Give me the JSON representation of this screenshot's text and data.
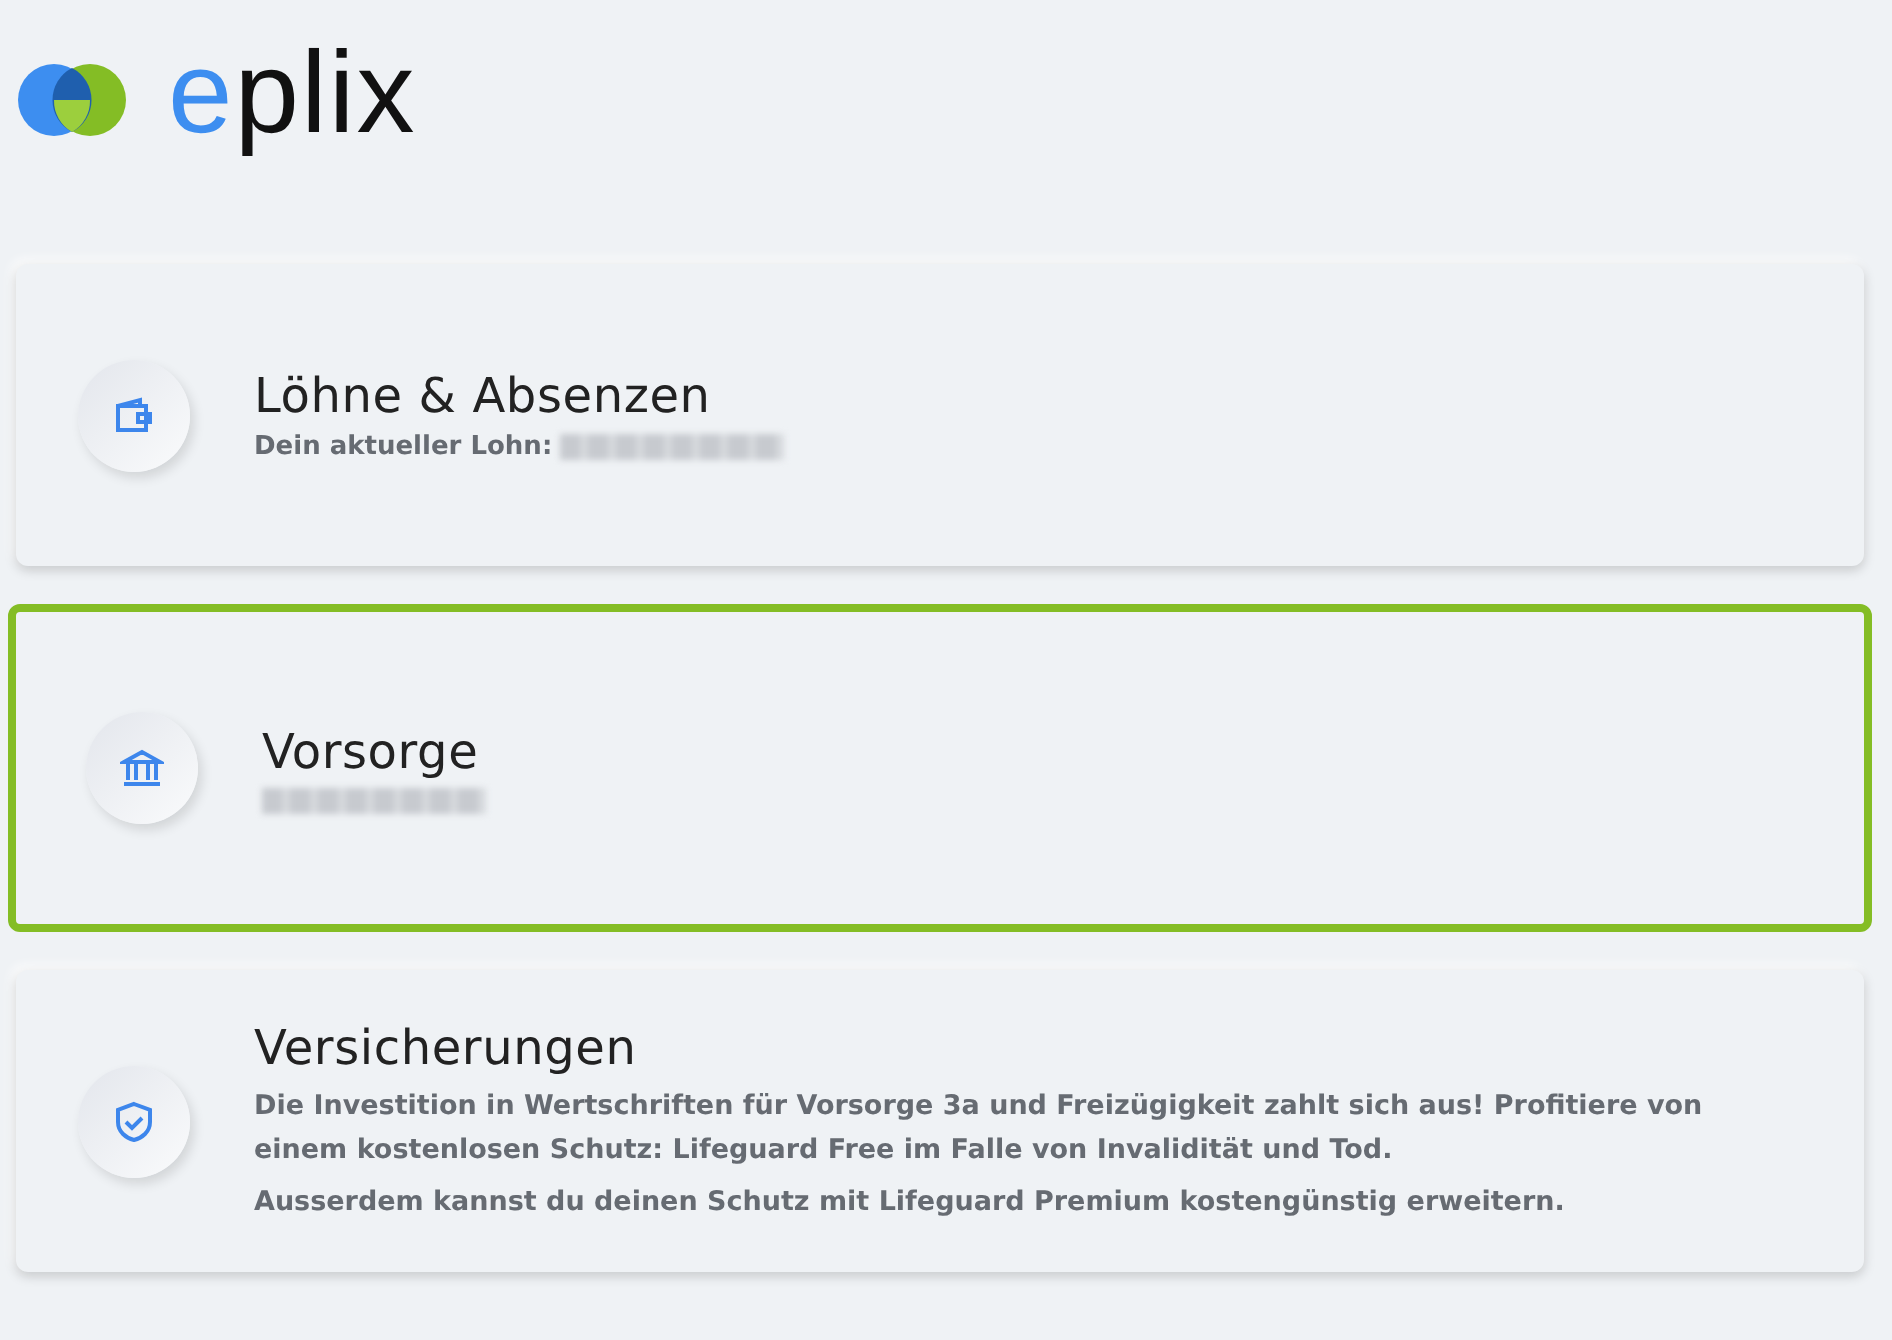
{
  "logo": {
    "text": "eplix"
  },
  "cards": [
    {
      "kind": "wallet",
      "title": "Löhne & Absenzen",
      "selected": false,
      "subtitle": "Dein aktueller Lohn:",
      "redacted": true
    },
    {
      "kind": "bank",
      "title": "Vorsorge",
      "selected": true,
      "redacted": true
    },
    {
      "kind": "shield",
      "title": "Versicherungen",
      "selected": false,
      "redacted": false,
      "paragraphs": [
        "Die Investition in Wertschriften für Vorsorge 3a und Freizügigkeit zahlt sich aus! Profitiere von einem kostenlosen Schutz: Lifeguard Free im Falle von Invalidität und Tod.",
        "Ausserdem kannst du deinen Schutz mit Lifeguard Premium kostengünstig erweitern."
      ]
    }
  ]
}
